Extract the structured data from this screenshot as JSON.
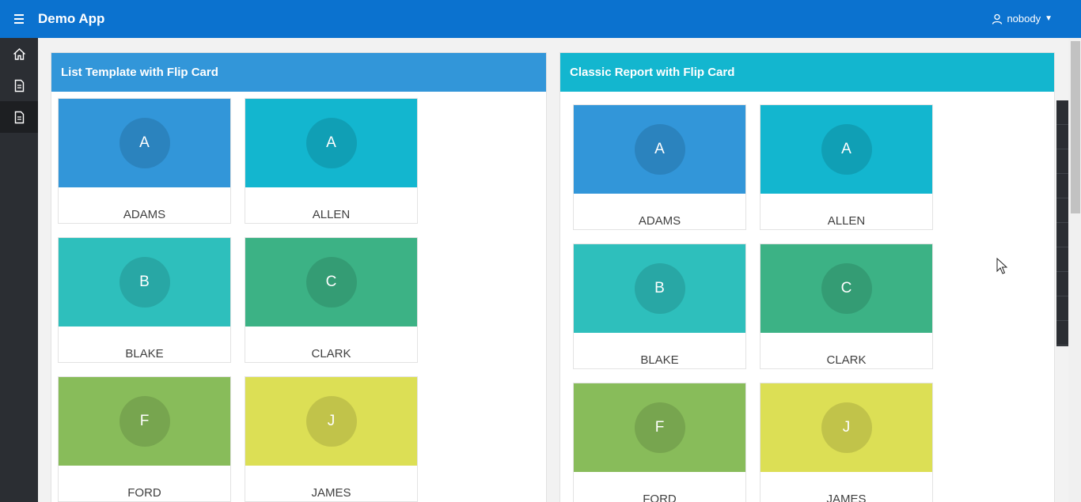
{
  "header": {
    "title": "Demo App",
    "user": "nobody"
  },
  "sidebar": {
    "items": [
      {
        "name": "home",
        "icon": "home-icon"
      },
      {
        "name": "page-1",
        "icon": "document-icon"
      },
      {
        "name": "page-2",
        "icon": "document-icon"
      }
    ]
  },
  "regions": {
    "left": {
      "title": "List Template with Flip Card"
    },
    "right": {
      "title": "Classic Report with Flip Card"
    }
  },
  "cards": [
    {
      "initial": "A",
      "name": "ADAMS",
      "color": "#3296d9"
    },
    {
      "initial": "A",
      "name": "ALLEN",
      "color": "#13b6cf"
    },
    {
      "initial": "B",
      "name": "BLAKE",
      "color": "#2ebfbc"
    },
    {
      "initial": "C",
      "name": "CLARK",
      "color": "#3cb285"
    },
    {
      "initial": "F",
      "name": "FORD",
      "color": "#88bc5a"
    },
    {
      "initial": "J",
      "name": "JAMES",
      "color": "#dcdf55"
    }
  ]
}
